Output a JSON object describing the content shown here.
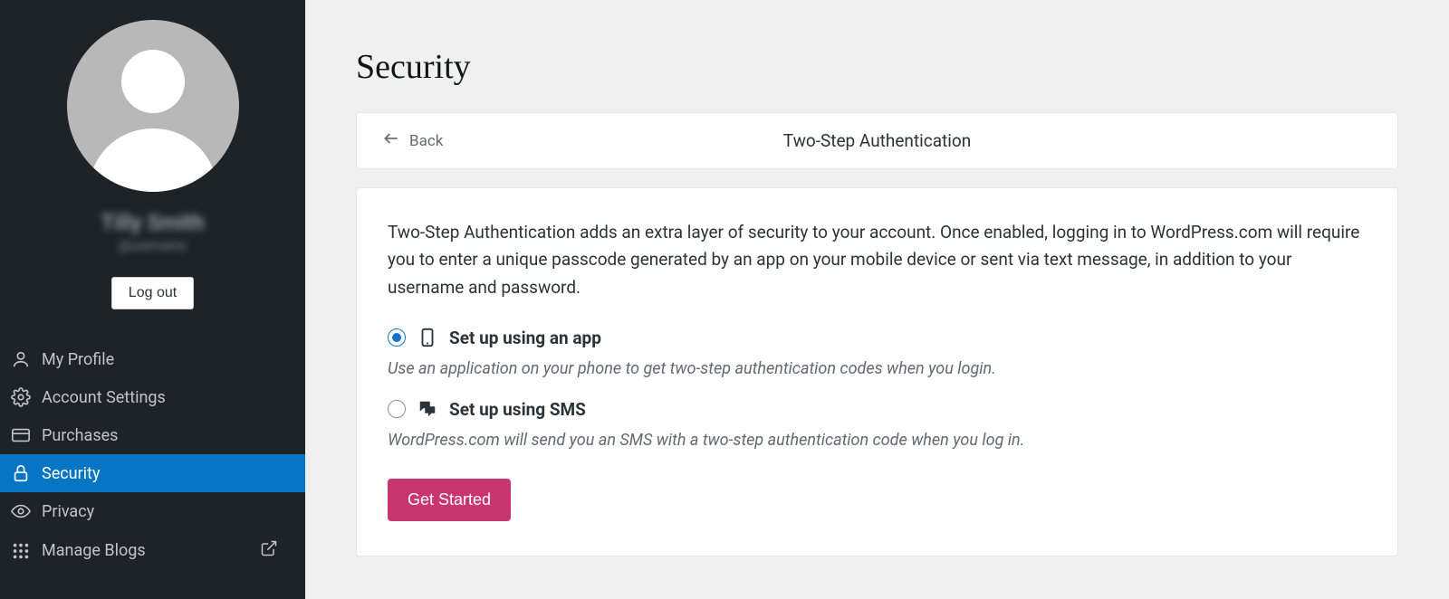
{
  "sidebar": {
    "profile": {
      "name": "Tilly Smith",
      "handle": "@username"
    },
    "logout_label": "Log out",
    "items": [
      {
        "label": "My Profile",
        "icon": "person-icon",
        "active": false
      },
      {
        "label": "Account Settings",
        "icon": "gear-icon",
        "active": false
      },
      {
        "label": "Purchases",
        "icon": "card-icon",
        "active": false
      },
      {
        "label": "Security",
        "icon": "lock-icon",
        "active": true
      },
      {
        "label": "Privacy",
        "icon": "eye-icon",
        "active": false
      },
      {
        "label": "Manage Blogs",
        "icon": "grid-icon",
        "active": false,
        "external": true
      }
    ]
  },
  "main": {
    "title": "Security",
    "back_label": "Back",
    "panel_title": "Two-Step Authentication",
    "description": "Two-Step Authentication adds an extra layer of security to your account. Once enabled, logging in to WordPress.com will require you to enter a unique passcode generated by an app on your mobile device or sent via text message, in addition to your username and password.",
    "options": [
      {
        "title": "Set up using an app",
        "desc": "Use an application on your phone to get two-step authentication codes when you login.",
        "selected": true,
        "icon": "phone-icon"
      },
      {
        "title": "Set up using SMS",
        "desc": "WordPress.com will send you an SMS with a two-step authentication code when you log in.",
        "selected": false,
        "icon": "chat-icon"
      }
    ],
    "get_started_label": "Get Started"
  }
}
